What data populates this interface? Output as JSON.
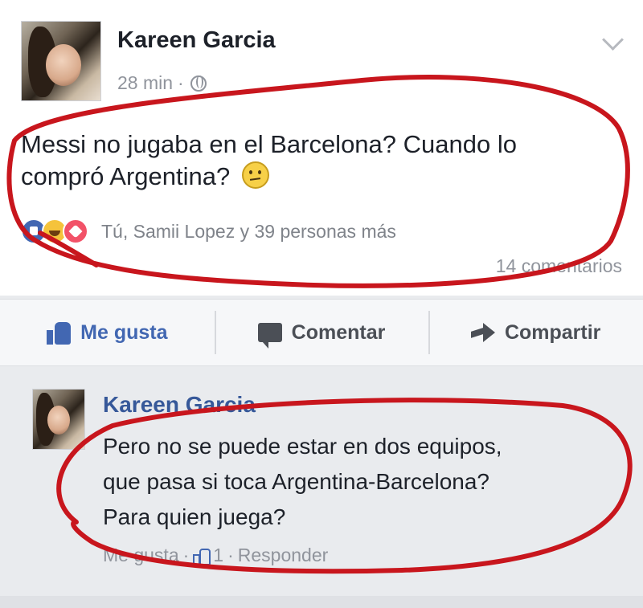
{
  "post": {
    "author": "Kareen Garcia",
    "time": "28 min",
    "separator": "·",
    "text_line1": "Messi no jugaba en el Barcelona? Cuando lo",
    "text_line2": "compró Argentina?",
    "reactions_text": "Tú, Samii Lopez y 39 personas más",
    "comments_count": "14 comentarios"
  },
  "actions": {
    "like": "Me gusta",
    "comment": "Comentar",
    "share": "Compartir"
  },
  "comment": {
    "author": "Kareen Garcia",
    "line1": "Pero no se puede estar en dos equipos,",
    "line2": "que pasa si toca Argentina-Barcelona?",
    "line3": "Para quien juega?",
    "like_label": "Me gusta",
    "separator": "·",
    "like_count": "1",
    "reply_label": "Responder"
  },
  "icons": {
    "globe": "globe-icon",
    "chevron": "chevron-down-icon",
    "emoji": "confused-face-icon",
    "reactions": [
      "like-reaction-icon",
      "haha-reaction-icon",
      "love-reaction-icon"
    ],
    "like": "thumbs-up-icon",
    "comment": "speech-bubble-icon",
    "share": "share-arrow-icon"
  },
  "colors": {
    "facebook_blue": "#4267b2",
    "link_blue": "#365899",
    "annotation_red": "#c8161d",
    "background": "#e9ebee"
  }
}
